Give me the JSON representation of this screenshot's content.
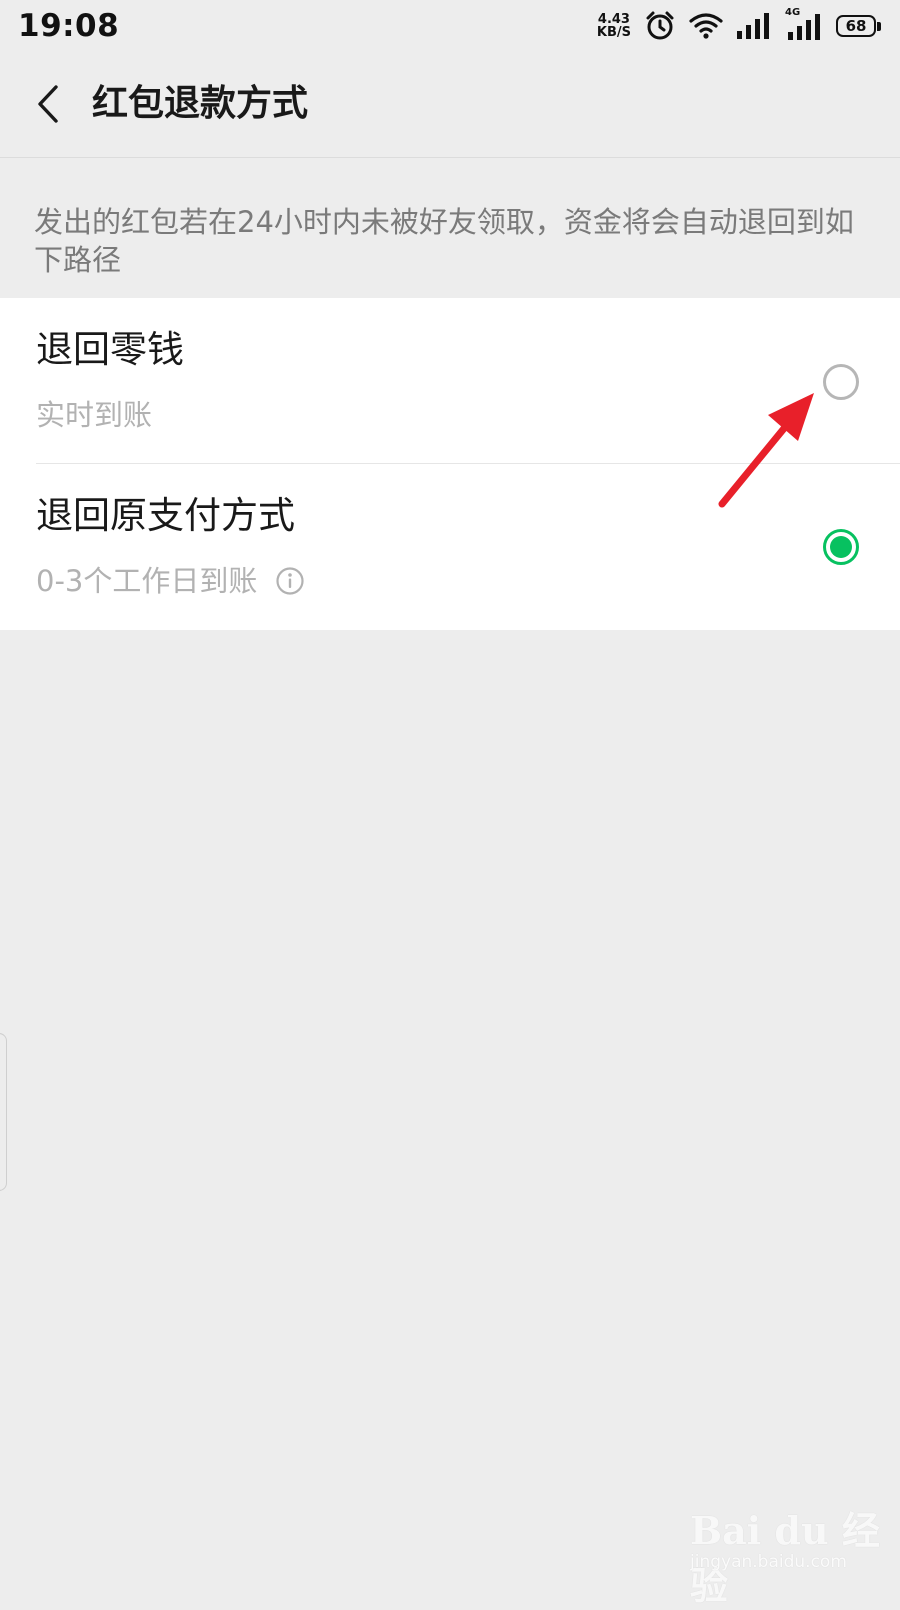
{
  "status_bar": {
    "time": "19:08",
    "net_speed_value": "4.43",
    "net_speed_unit": "KB/S",
    "network_type": "4G",
    "battery_level": "68"
  },
  "nav": {
    "title": "红包退款方式"
  },
  "description": "发出的红包若在24小时内未被好友领取，资金将会自动退回到如下路径",
  "options": [
    {
      "title": "退回零钱",
      "subtitle": "实时到账",
      "selected": false
    },
    {
      "title": "退回原支付方式",
      "subtitle": "0-3个工作日到账",
      "selected": true
    }
  ],
  "colors": {
    "accent": "#07c160",
    "annotation": "#e8202a",
    "background": "#ededed"
  },
  "watermark": {
    "main": "Bai du 经验",
    "sub": "jingyan.baidu.com"
  }
}
